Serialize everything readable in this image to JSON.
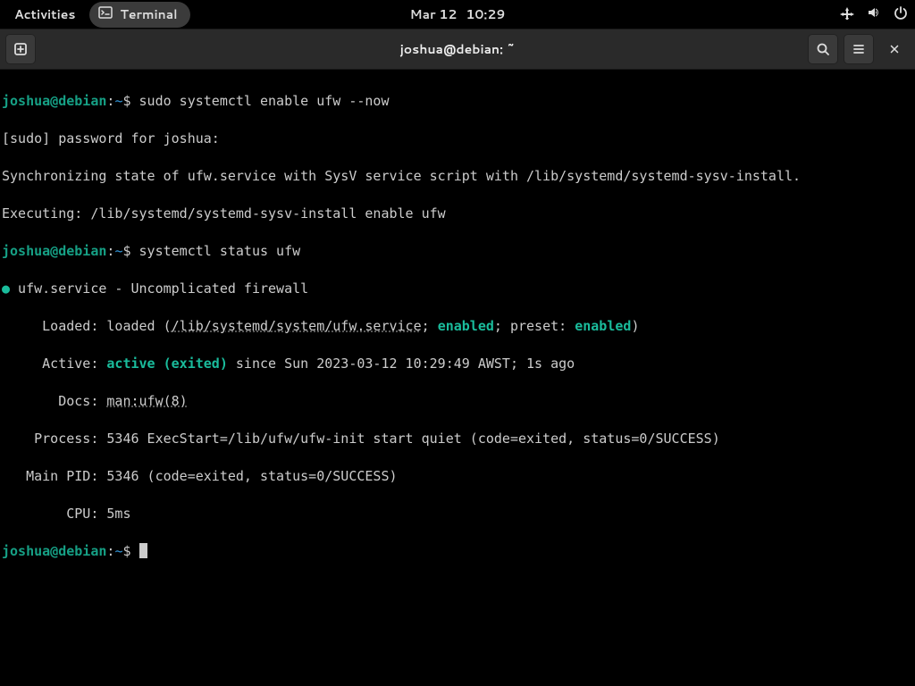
{
  "topbar": {
    "activities": "Activities",
    "app_label": "Terminal",
    "date": "Mar 12",
    "time": "10:29"
  },
  "window": {
    "title": "joshua@debian: ~"
  },
  "prompt": {
    "user_host": "joshua@debian",
    "colon": ":",
    "path": "~",
    "dollar": "$ "
  },
  "cmd1": "sudo systemctl enable ufw --now",
  "out1_l1": "[sudo] password for joshua: ",
  "out1_l2": "Synchronizing state of ufw.service with SysV service script with /lib/systemd/systemd-sysv-install.",
  "out1_l3": "Executing: /lib/systemd/systemd-sysv-install enable ufw",
  "cmd2": "systemctl status ufw",
  "status": {
    "dot": "●",
    "header": " ufw.service - Uncomplicated firewall",
    "loaded_pre": "     Loaded: loaded (",
    "loaded_path": "/lib/systemd/system/ufw.service",
    "loaded_mid1": "; ",
    "loaded_enabled1": "enabled",
    "loaded_mid2": "; preset: ",
    "loaded_enabled2": "enabled",
    "loaded_post": ")",
    "active_pre": "     Active: ",
    "active_state": "active (exited)",
    "active_post": " since Sun 2023-03-12 10:29:49 AWST; 1s ago",
    "docs_pre": "       Docs: ",
    "docs_link": "man:ufw(8)",
    "process": "    Process: 5346 ExecStart=/lib/ufw/ufw-init start quiet (code=exited, status=0/SUCCESS)",
    "main_pid": "   Main PID: 5346 (code=exited, status=0/SUCCESS)",
    "cpu": "        CPU: 5ms"
  }
}
